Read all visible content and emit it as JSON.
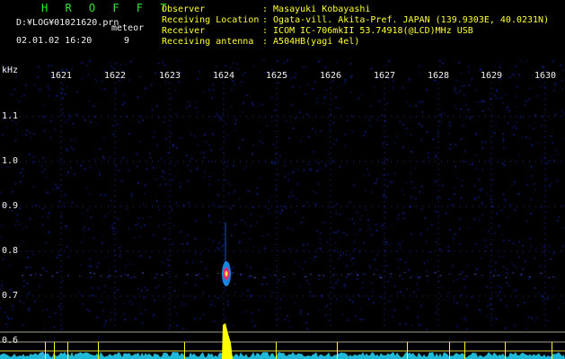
{
  "header": {
    "logo": "H R O F F T",
    "log_path": "D:¥LOG¥01021620.prn",
    "mode": "meteor",
    "datetime": "02.01.02 16:20",
    "count": "9",
    "info": [
      {
        "label": "Observer",
        "value": ": Masayuki Kobayashi"
      },
      {
        "label": "Receiving Location",
        "value": ": Ogata-vill. Akita-Pref. JAPAN (139.9303E, 40.0231N)"
      },
      {
        "label": "Receiver",
        "value": ": ICOM IC-706mkII 53.74918(@LCD)MHz USB"
      },
      {
        "label": "Receiving antenna",
        "value": ": A504HB(yagi 4el)"
      }
    ]
  },
  "x_axis": {
    "unit": "kHz",
    "ticks": [
      "1621",
      "1622",
      "1623",
      "1624",
      "1625",
      "1626",
      "1627",
      "1628",
      "1629",
      "1630"
    ]
  },
  "y_axis": {
    "ticks": [
      "1.1",
      "1.0",
      "0.9",
      "0.8",
      "0.7",
      "0.6"
    ]
  },
  "colors": {
    "background": "#000000",
    "logo": "#33e633",
    "text": "#f2f2f2",
    "accent_text": "#ffff33",
    "noise": "#0b1a7a",
    "spectrum_baseline": "#22ccee",
    "spectrum_peak": "#ffff00",
    "echo_core": "#ff2266"
  }
}
